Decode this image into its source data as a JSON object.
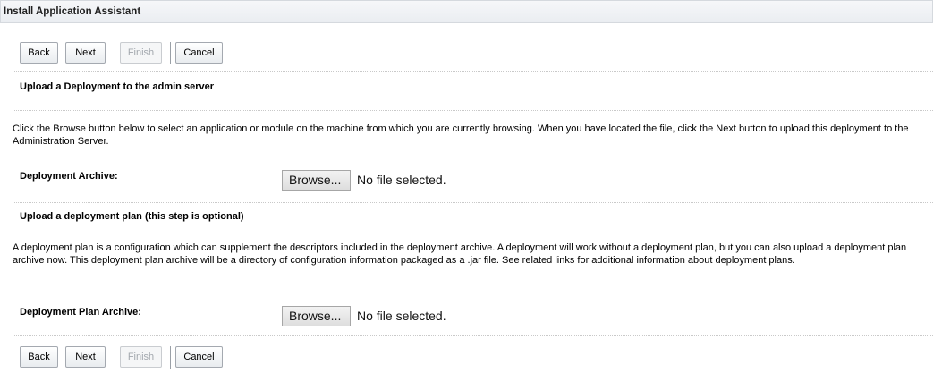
{
  "header": {
    "title": "Install Application Assistant"
  },
  "toolbar": {
    "back": "Back",
    "next": "Next",
    "finish": "Finish",
    "cancel": "Cancel"
  },
  "upload_deployment": {
    "title": "Upload a Deployment to the admin server",
    "description": "Click the Browse button below to select an application or module on the machine from which you are currently browsing. When you have located the file, click the Next button to upload this deployment to the Administration Server.",
    "archive_label": "Deployment Archive:",
    "browse_label": "Browse...",
    "file_status": "No file selected."
  },
  "upload_plan": {
    "title": "Upload a deployment plan (this step is optional)",
    "description": "A deployment plan is a configuration which can supplement the descriptors included in the deployment archive. A deployment will work without a deployment plan, but you can also upload a deployment plan archive now. This deployment plan archive will be a directory of configuration information packaged as a .jar file. See related links for additional information about deployment plans.",
    "archive_label": "Deployment Plan Archive:",
    "browse_label": "Browse...",
    "file_status": "No file selected."
  }
}
